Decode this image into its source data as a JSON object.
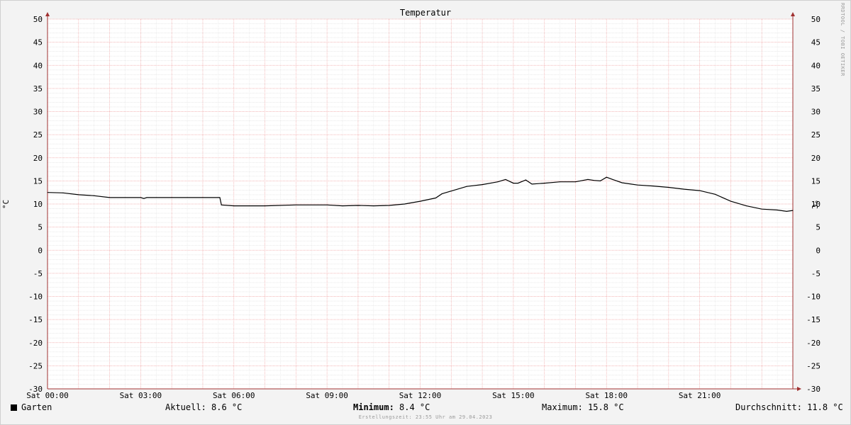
{
  "chart_data": {
    "type": "line",
    "title": "Temperatur",
    "ylabel": "°C",
    "ylim": [
      -30,
      50
    ],
    "y_ticks": [
      "50",
      "45",
      "40",
      "35",
      "30",
      "25",
      "20",
      "15",
      "10",
      "5",
      "0",
      "-5",
      "-10",
      "-15",
      "-20",
      "-25",
      "-30"
    ],
    "x_ticks": [
      "Sat 00:00",
      "Sat 03:00",
      "Sat 06:00",
      "Sat 09:00",
      "Sat 12:00",
      "Sat 15:00",
      "Sat 18:00",
      "Sat 21:00"
    ],
    "xlim_hours": [
      0,
      24
    ],
    "grid": true,
    "series": [
      {
        "name": "Garten",
        "color": "#000000",
        "x": [
          0,
          0.5,
          1,
          1.5,
          2,
          2.5,
          3,
          3.1,
          3.2,
          3.5,
          4,
          4.5,
          5,
          5.5,
          5.55,
          5.6,
          6,
          7,
          8,
          9,
          9.5,
          10,
          10.5,
          11,
          11.5,
          12,
          12.5,
          12.7,
          13,
          13.5,
          14,
          14.5,
          14.75,
          15,
          15.15,
          15.4,
          15.6,
          16,
          16.5,
          17,
          17.4,
          17.6,
          17.8,
          18,
          18.2,
          18.5,
          19,
          19.5,
          20,
          20.5,
          21,
          21.5,
          22,
          22.5,
          23,
          23.5,
          23.8,
          24
        ],
        "y": [
          12.5,
          12.4,
          12.0,
          11.8,
          11.4,
          11.4,
          11.4,
          11.2,
          11.4,
          11.4,
          11.4,
          11.4,
          11.4,
          11.4,
          11.4,
          9.8,
          9.6,
          9.6,
          9.8,
          9.8,
          9.6,
          9.7,
          9.6,
          9.7,
          10.0,
          10.6,
          11.3,
          12.2,
          12.8,
          13.8,
          14.2,
          14.8,
          15.3,
          14.5,
          14.5,
          15.2,
          14.3,
          14.5,
          14.8,
          14.8,
          15.3,
          15.1,
          15.0,
          15.8,
          15.3,
          14.6,
          14.1,
          13.9,
          13.6,
          13.2,
          12.9,
          12.1,
          10.6,
          9.6,
          8.9,
          8.7,
          8.4,
          8.6
        ]
      }
    ]
  },
  "legend": {
    "series_name": "Garten",
    "current": "Aktuell: 8.6 °C",
    "minimum_label": "Minimum:",
    "minimum_value": " 8.4 °C",
    "maximum": "Maximum: 15.8 °C",
    "average": "Durchschnitt: 11.8 °C"
  },
  "footer": "Erstellungszeit: 23:55 Uhr am 29.04.2023",
  "watermark": "RRDTOOL / TOBI OETIKER",
  "unit_label": "°C"
}
